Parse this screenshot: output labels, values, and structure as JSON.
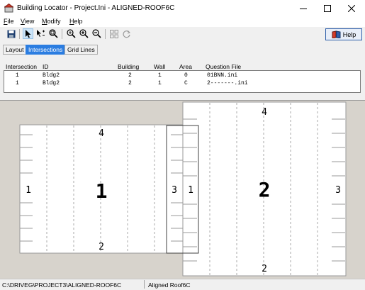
{
  "window": {
    "title": "Building Locator - Project.Ini - ALIGNED-ROOF6C"
  },
  "menu": [
    {
      "label": "File",
      "mnemonic": "F",
      "rest": "ile"
    },
    {
      "label": "View",
      "mnemonic": "V",
      "rest": "iew"
    },
    {
      "label": "Modify",
      "mnemonic": "M",
      "rest": "odify"
    },
    {
      "label": "Help",
      "mnemonic": "H",
      "rest": "elp"
    }
  ],
  "toolbar": {
    "icons": [
      "save-icon",
      "pointer-icon",
      "move-icon",
      "zoom-window-icon",
      "zoom-fit-icon",
      "zoom-in-icon",
      "zoom-out-icon",
      "grid-icon",
      "refresh-icon"
    ],
    "help_label": "Help"
  },
  "tabs": [
    {
      "label": "Layout",
      "active": false
    },
    {
      "label": "Intersections",
      "active": true
    },
    {
      "label": "Grid Lines",
      "active": false
    }
  ],
  "table": {
    "headers": [
      "Intersection",
      "ID",
      "Building",
      "Wall",
      "Area",
      "Question File"
    ],
    "rows": [
      [
        "1",
        "Bldg2",
        "2",
        "1",
        "0",
        "01BNN.ini"
      ],
      [
        "1",
        "Bldg2",
        "2",
        "1",
        "C",
        "2-------.ini"
      ]
    ]
  },
  "drawing": {
    "building1": {
      "label": "1",
      "walls": {
        "top": "4",
        "bottom": "2",
        "left": "1",
        "right": "3"
      }
    },
    "building2": {
      "label": "2",
      "walls": {
        "top": "4",
        "bottom": "2",
        "left": "1",
        "right": "3"
      }
    }
  },
  "status": {
    "path": "C:\\DRIVEG\\PROJECT3\\ALIGNED-ROOF6C",
    "view": "Aligned Roof6C"
  },
  "colors": {
    "selected_tab": "#2b7de1",
    "canvas_bg": "#d7d3cc",
    "help_border": "#2f5faa"
  }
}
